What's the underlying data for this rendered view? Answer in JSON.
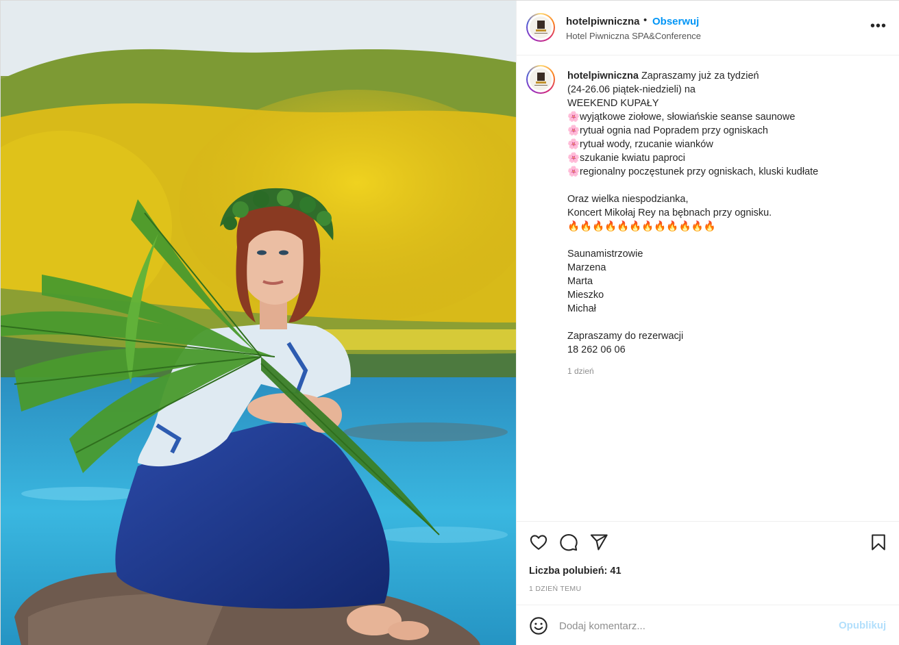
{
  "post": {
    "username": "hotelpiwniczna",
    "separator": "•",
    "follow_label": "Obserwuj",
    "location": "Hotel Piwniczna SPA&Conference",
    "more_icon": "more-horizontal-icon"
  },
  "caption": {
    "username": "hotelpiwniczna",
    "text": " Zapraszamy już za tydzień\n(24-26.06 piątek-niedzieli) na\nWEEKEND KUPAŁY\n🌸wyjątkowe ziołowe, słowiańskie seanse saunowe\n🌸rytuał ognia nad Popradem przy ogniskach\n🌸rytuał wody, rzucanie wianków\n🌸szukanie kwiatu paproci\n🌸regionalny poczęstunek przy ogniskach, kluski kudłate\n\nOraz wielka niespodzianka,\nKoncert Mikołaj Rey na bębnach przy ognisku.\n🔥🔥🔥🔥🔥🔥🔥🔥🔥🔥🔥🔥\n\nSaunamistrzowie\nMarzena\nMarta\nMieszko\nMichał\n\nZapraszamy do rezerwacji\n18 262 06 06",
    "time": "1 dzień"
  },
  "actions": {
    "like_icon": "heart-icon",
    "comment_icon": "comment-icon",
    "share_icon": "send-icon",
    "save_icon": "bookmark-icon",
    "likes": "Liczba polubień: 41",
    "posted_ago": "1 DZIEŃ TEMU"
  },
  "comment_box": {
    "emoji_icon": "emoji-icon",
    "placeholder": "Dodaj komentarz...",
    "publish_label": "Opublikuj"
  },
  "colors": {
    "accent": "#0095f6",
    "publish_disabled": "#b2dffc",
    "text": "#262626",
    "muted": "#8e8e8e"
  }
}
